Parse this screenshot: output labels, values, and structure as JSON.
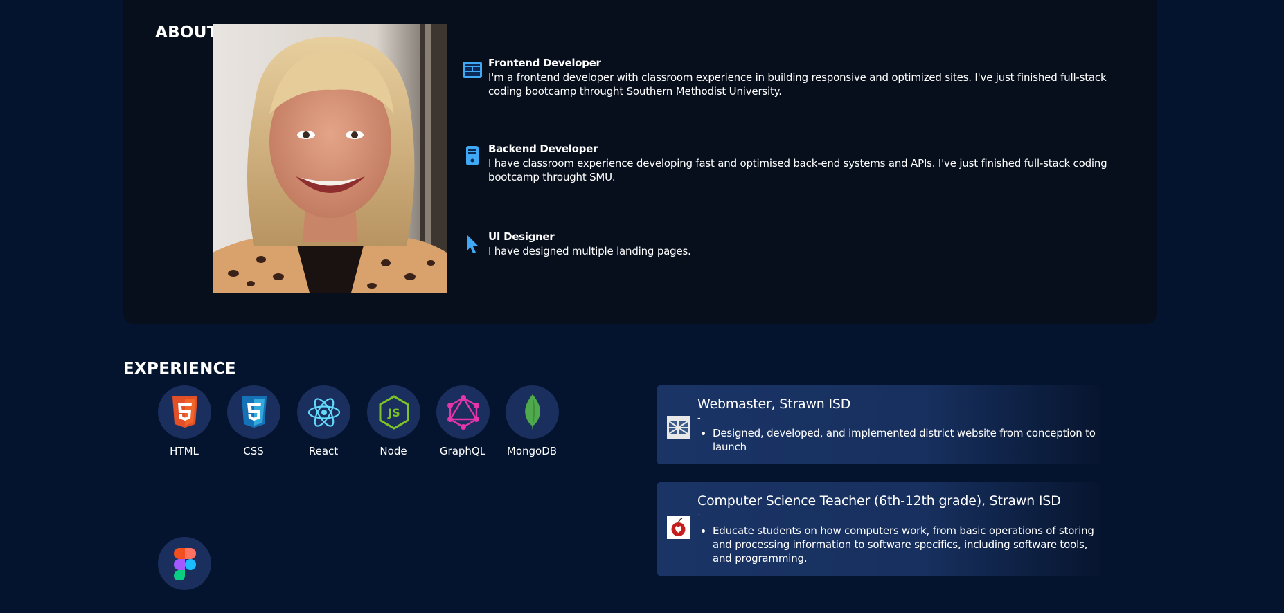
{
  "about": {
    "heading": "ABOUT",
    "roles": [
      {
        "icon": "browser-window-icon",
        "title": "Frontend Developer",
        "description": "I'm a frontend developer with classroom experience in building responsive and optimized sites. I've just finished full-stack coding bootcamp throught Southern Methodist University."
      },
      {
        "icon": "server-icon",
        "title": "Backend Developer",
        "description": "I have classroom experience developing fast and optimised back-end systems and APIs. I've just finished full-stack coding bootcamp throught SMU."
      },
      {
        "icon": "cursor-icon",
        "title": "UI Designer",
        "description": "I have designed multiple landing pages."
      }
    ]
  },
  "experience": {
    "heading": "EXPERIENCE",
    "skills": [
      {
        "label": "HTML",
        "icon": "html5-icon"
      },
      {
        "label": "CSS",
        "icon": "css3-icon"
      },
      {
        "label": "React",
        "icon": "react-icon"
      },
      {
        "label": "Node",
        "icon": "nodejs-icon"
      },
      {
        "label": "GraphQL",
        "icon": "graphql-icon"
      },
      {
        "label": "MongoDB",
        "icon": "mongodb-icon"
      },
      {
        "label": "",
        "icon": "figma-icon"
      }
    ],
    "jobs": [
      {
        "title": "Webmaster, Strawn ISD",
        "dates": "-",
        "logo": "strawn-isd-logo",
        "bullets": [
          "Designed, developed, and implemented district website from conception to launch"
        ]
      },
      {
        "title": "Computer Science Teacher (6th-12th grade), Strawn ISD",
        "dates": "-",
        "logo": "teaching-apple-logo",
        "bullets": [
          "Educate students on how computers work, from basic operations of storing and processing information to software specifics, including software tools, and programming."
        ]
      }
    ]
  },
  "colors": {
    "page_bg": "#04142e",
    "panel_bg": "#080f1c",
    "skill_circle": "#1b2f5f",
    "accent_blue": "#3fa9f5"
  }
}
